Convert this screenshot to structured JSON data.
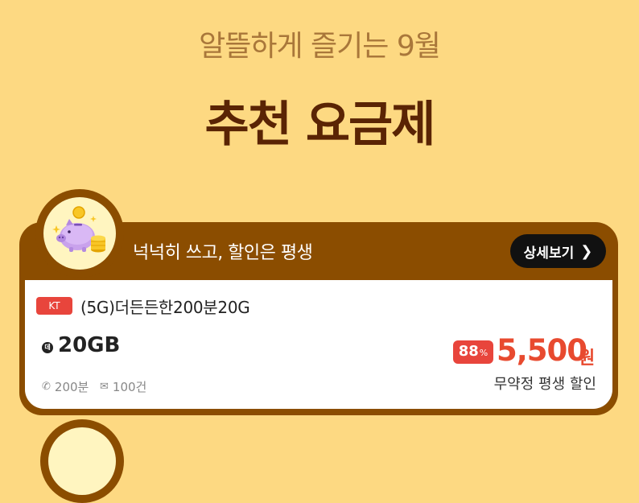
{
  "header": {
    "subtitle": "알뜰하게 즐기는 9월",
    "title": "추천 요금제"
  },
  "plan_card": {
    "icon": "piggy-bank-icon",
    "slogan": "넉넉히 쓰고, 할인은 평생",
    "detail_button_label": "상세보기",
    "carrier": "KT",
    "plan_name": "(5G)더든든한200분20G",
    "data_icon_label": "데",
    "data": "20GB",
    "calls": "200분",
    "sms": "100건",
    "discount_value": "88",
    "discount_unit": "%",
    "price": "5,500",
    "price_unit": "원",
    "contract_note": "무약정 평생 할인"
  },
  "colors": {
    "background": "#FDD982",
    "card_header": "#8B4D00",
    "accent_red": "#E8453C",
    "title": "#5A2404"
  }
}
